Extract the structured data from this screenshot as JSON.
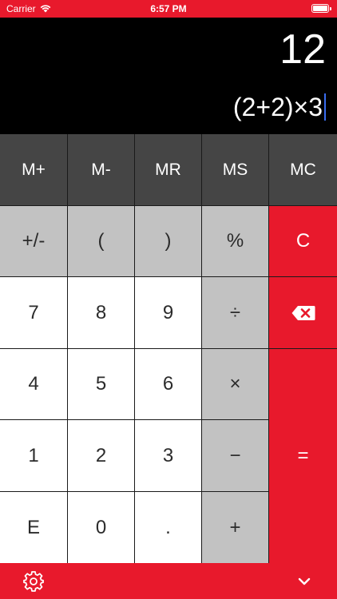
{
  "status_bar": {
    "carrier": "Carrier",
    "time": "6:57 PM"
  },
  "display": {
    "result": "12",
    "expression": "(2+2)×3"
  },
  "memory_row": [
    "M+",
    "M-",
    "MR",
    "MS",
    "MC"
  ],
  "keys": {
    "sign": "+/-",
    "open_paren": "(",
    "close_paren": ")",
    "percent": "%",
    "clear": "C",
    "seven": "7",
    "eight": "8",
    "nine": "9",
    "divide": "÷",
    "four": "4",
    "five": "5",
    "six": "6",
    "multiply": "×",
    "one": "1",
    "two": "2",
    "three": "3",
    "minus": "−",
    "exp": "E",
    "zero": "0",
    "dot": ".",
    "plus": "+",
    "equals": "="
  },
  "icons": {
    "backspace": "backspace-icon",
    "settings": "gear-icon",
    "collapse": "chevron-down-icon"
  },
  "colors": {
    "accent": "#e8192c",
    "memory_bg": "#454545",
    "function_bg": "#c2c2c2",
    "digit_bg": "#ffffff",
    "display_bg": "#000000"
  }
}
